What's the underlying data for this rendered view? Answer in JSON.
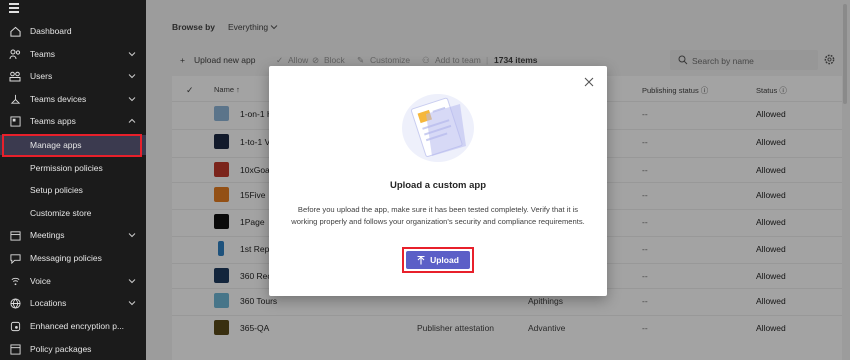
{
  "sidebar": {
    "items": [
      {
        "label": "Dashboard",
        "icon": "home-icon"
      },
      {
        "label": "Teams",
        "icon": "teams-icon",
        "chevron": "down"
      },
      {
        "label": "Users",
        "icon": "users-icon",
        "chevron": "down"
      },
      {
        "label": "Teams devices",
        "icon": "devices-icon",
        "chevron": "down"
      },
      {
        "label": "Teams apps",
        "icon": "apps-icon",
        "chevron": "up"
      },
      {
        "label": "Manage apps",
        "sub": true,
        "active": true
      },
      {
        "label": "Permission policies",
        "sub": true
      },
      {
        "label": "Setup policies",
        "sub": true
      },
      {
        "label": "Customize store",
        "sub": true
      },
      {
        "label": "Meetings",
        "icon": "meetings-icon",
        "chevron": "down"
      },
      {
        "label": "Messaging policies",
        "icon": "messaging-icon"
      },
      {
        "label": "Voice",
        "icon": "voice-icon",
        "chevron": "down"
      },
      {
        "label": "Locations",
        "icon": "globe-icon",
        "chevron": "down"
      },
      {
        "label": "Enhanced encryption p...",
        "icon": "encryption-icon"
      },
      {
        "label": "Policy packages",
        "icon": "packages-icon"
      }
    ]
  },
  "browse": {
    "label": "Browse by",
    "value": "Everything"
  },
  "toolbar": {
    "upload": "Upload new app",
    "allow": "Allow",
    "block": "Block",
    "customize": "Customize",
    "add_to_team": "Add to team",
    "count": "1734 items",
    "search_placeholder": "Search by name"
  },
  "table": {
    "headers": {
      "name": "Name",
      "publishing_status": "Publishing status",
      "status": "Status"
    },
    "rows": [
      {
        "name": "1-on-1 H",
        "publisher": "",
        "developer": "",
        "pstat": "--",
        "status": "Allowed",
        "color": "#8fb6d8"
      },
      {
        "name": "1-to-1 V",
        "publisher": "",
        "developer": "",
        "pstat": "--",
        "status": "Allowed",
        "color": "#1d2a44"
      },
      {
        "name": "10xGoal",
        "publisher": "",
        "developer": "",
        "pstat": "--",
        "status": "Allowed",
        "color": "#c0392b"
      },
      {
        "name": "15Five",
        "publisher": "",
        "developer": "",
        "pstat": "--",
        "status": "Allowed",
        "color": "#e67e22"
      },
      {
        "name": "1Page",
        "publisher": "",
        "developer": "",
        "pstat": "--",
        "status": "Allowed",
        "color": "#111111"
      },
      {
        "name": "1st Repo",
        "publisher": "",
        "developer": "",
        "pstat": "--",
        "status": "Allowed",
        "color": "#2f80c3"
      },
      {
        "name": "360 Reco",
        "publisher": "",
        "developer": "",
        "pstat": "--",
        "status": "Allowed",
        "color": "#1e3a5f"
      },
      {
        "name": "360 Tours",
        "publisher": "",
        "developer": "Apithings",
        "pstat": "--",
        "status": "Allowed",
        "color": "#6fb7d6"
      },
      {
        "name": "365-QA",
        "publisher": "Publisher attestation",
        "developer": "Advantive",
        "pstat": "--",
        "status": "Allowed",
        "color": "#5a4a1a"
      }
    ]
  },
  "modal": {
    "title": "Upload a custom app",
    "body": "Before you upload the app, make sure it has been tested completely. Verify that it is working properly and follows your organization's security and compliance requirements.",
    "upload_label": "Upload"
  },
  "colors": {
    "accent": "#5b5fc7",
    "highlight": "#e8202b",
    "sidebar": "#1b1b1b"
  }
}
